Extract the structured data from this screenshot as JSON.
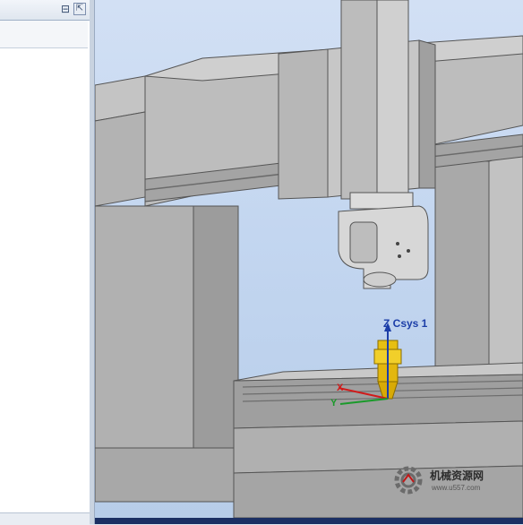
{
  "panel": {
    "minimize_icon": "minimize-icon",
    "restore_icon": "restore-window-icon"
  },
  "viewport": {
    "csys_label": "Z Csys 1",
    "axis_x": "X",
    "axis_y": "Y"
  },
  "watermark": {
    "text": "机械资源网",
    "url": "www.u557.com"
  },
  "colors": {
    "background_top": "#d2e0f4",
    "machine_gray": "#b8b8b8",
    "tool_gold": "#e8c21a",
    "csys_blue": "#1c3ea8",
    "bottom_bar": "#1b2f63"
  }
}
